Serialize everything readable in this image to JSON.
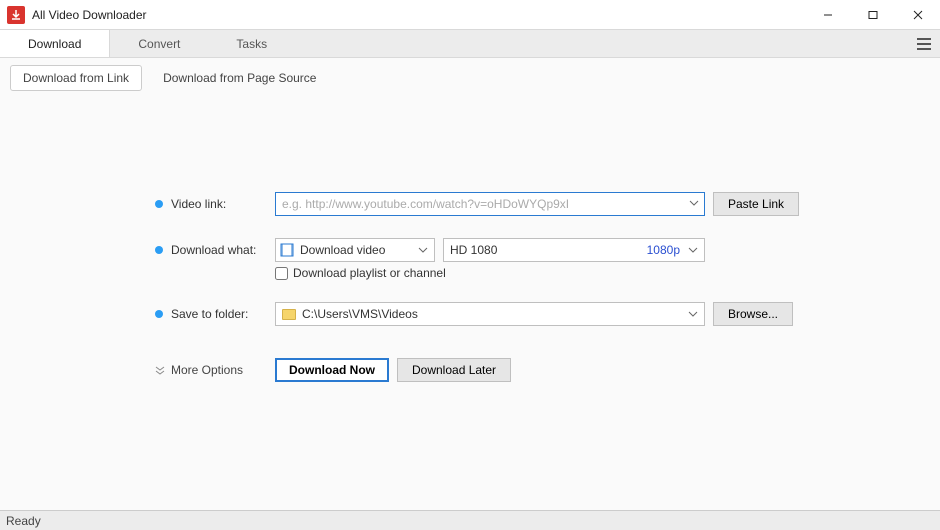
{
  "title": "All Video Downloader",
  "tabs": {
    "download": "Download",
    "convert": "Convert",
    "tasks": "Tasks"
  },
  "subtabs": {
    "from_link": "Download from Link",
    "from_source": "Download from Page Source"
  },
  "labels": {
    "video_link": "Video link:",
    "download_what": "Download what:",
    "save_to": "Save to folder:",
    "more_options": "More Options"
  },
  "url_placeholder": "e.g. http://www.youtube.com/watch?v=oHDoWYQp9xI",
  "paste_link": "Paste Link",
  "what_select": "Download video",
  "quality_label": "HD 1080",
  "quality_value": "1080p",
  "playlist_checkbox": "Download playlist or channel",
  "folder_path": "C:\\Users\\VMS\\Videos",
  "browse": "Browse...",
  "download_now": "Download Now",
  "download_later": "Download Later",
  "status": "Ready"
}
